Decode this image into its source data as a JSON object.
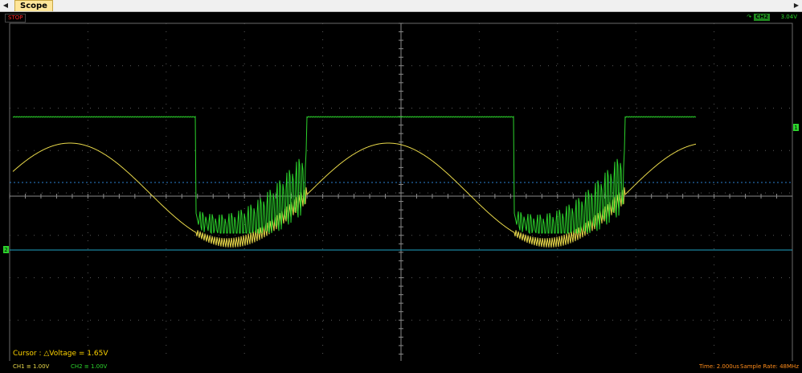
{
  "tabs": {
    "active_label": "Scope"
  },
  "status": {
    "run_state": "STOP"
  },
  "trigger": {
    "channel": "CH2",
    "level": "3.04V"
  },
  "markers": {
    "ch1": "1",
    "ch2": "2"
  },
  "cursor": {
    "text": "Cursor : △Voltage = 1.65V"
  },
  "footer": {
    "ch1_label": "CH1",
    "ch1_value": "1.00V",
    "ch2_label": "CH2",
    "ch2_value": "1.00V",
    "time": "Time: 2.000us",
    "sample_rate": "Sample Rate: 48MHz"
  },
  "colors": {
    "ch1": "#e8d84a",
    "ch2": "#2cd32c",
    "cursor": "#1fa4c4",
    "grid": "#6a6a6a"
  }
}
